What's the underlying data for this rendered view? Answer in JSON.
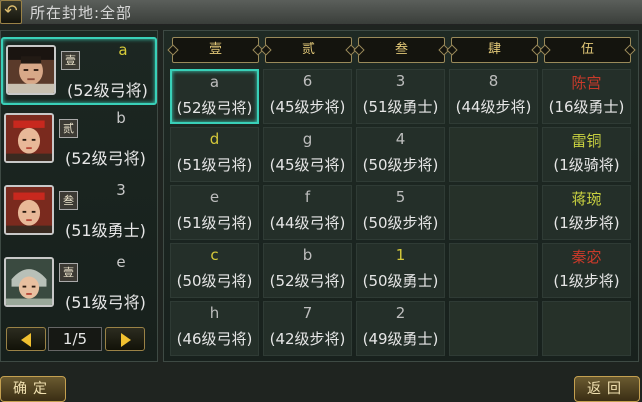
{
  "header": {
    "back_label": "↶",
    "title": "所在封地:全部"
  },
  "generals": [
    {
      "name": "a",
      "rank": "壹",
      "level": "(52级弓将)",
      "name_color": "default",
      "selected": true
    },
    {
      "name": "b",
      "rank": "贰",
      "level": "(52级弓将)",
      "name_color": "default",
      "selected": false
    },
    {
      "name": "3",
      "rank": "叁",
      "level": "(51级勇士)",
      "name_color": "default",
      "selected": false
    },
    {
      "name": "e",
      "rank": "壹",
      "level": "(51级弓将)",
      "name_color": "default",
      "selected": false
    }
  ],
  "pager": {
    "current": 1,
    "total": 5,
    "label": "1/5"
  },
  "columns": [
    "壹",
    "贰",
    "叁",
    "肆",
    "伍"
  ],
  "grid": [
    [
      {
        "name": "a",
        "level": "(52级弓将)",
        "color": "default",
        "selected": true
      },
      {
        "name": "6",
        "level": "(45级步将)",
        "color": "default"
      },
      {
        "name": "3",
        "level": "(51级勇士)",
        "color": "default"
      },
      {
        "name": "8",
        "level": "(44级步将)",
        "color": "default"
      },
      {
        "name": "陈宫",
        "level": "(16级勇士)",
        "color": "red"
      }
    ],
    [
      {
        "name": "d",
        "level": "(51级弓将)",
        "color": "yellow"
      },
      {
        "name": "g",
        "level": "(45级弓将)",
        "color": "default"
      },
      {
        "name": "4",
        "level": "(50级步将)",
        "color": "default"
      },
      null,
      {
        "name": "雷铜",
        "level": "(1级骑将)",
        "color": "green"
      }
    ],
    [
      {
        "name": "e",
        "level": "(51级弓将)",
        "color": "default"
      },
      {
        "name": "f",
        "level": "(44级弓将)",
        "color": "default"
      },
      {
        "name": "5",
        "level": "(50级步将)",
        "color": "default"
      },
      null,
      {
        "name": "蒋琬",
        "level": "(1级步将)",
        "color": "green"
      }
    ],
    [
      {
        "name": "c",
        "level": "(50级弓将)",
        "color": "yellow"
      },
      {
        "name": "b",
        "level": "(52级弓将)",
        "color": "default"
      },
      {
        "name": "1",
        "level": "(50级勇士)",
        "color": "yellow"
      },
      null,
      {
        "name": "秦宓",
        "level": "(1级步将)",
        "color": "red"
      }
    ],
    [
      {
        "name": "h",
        "level": "(46级弓将)",
        "color": "default"
      },
      {
        "name": "7",
        "level": "(42级步将)",
        "color": "default"
      },
      {
        "name": "2",
        "level": "(49级勇士)",
        "color": "default"
      },
      null,
      null
    ]
  ],
  "buttons": {
    "confirm": "确定",
    "back": "返回"
  },
  "colors": {
    "accent_selection": "#39d0b8",
    "name_yellow": "#d4c83a",
    "name_red": "#c83a2a",
    "name_green": "#c8d040",
    "header_gold": "#e2c878"
  },
  "icons": {
    "back": "back-arrow-icon",
    "prev": "prev-arrow-icon",
    "next": "next-arrow-icon"
  }
}
